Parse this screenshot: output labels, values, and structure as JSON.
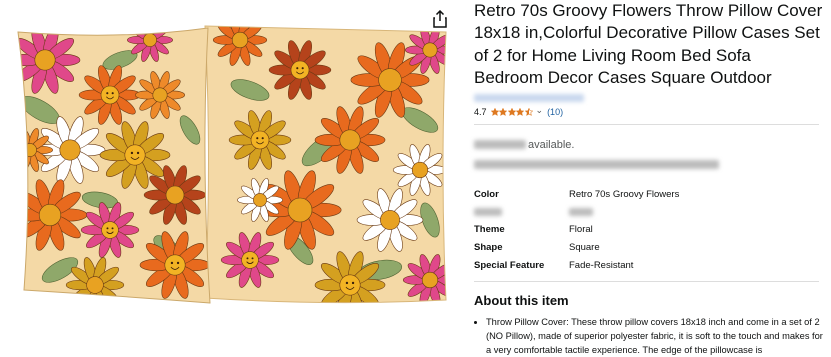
{
  "product": {
    "title": "Retro 70s Groovy Flowers Throw Pillow Cover 18x18 in,Colorful Decorative Pillow Cases Set of 2 for Home Living Room Bed Sofa Bedroom Decor Cases Square Outdoor",
    "rating": "4.7",
    "rating_stars": 4.5,
    "rating_count": "(10)",
    "availability_partial": "available.",
    "colors": {
      "star": "#de7921",
      "link": "#2162a1",
      "text": "#0f1111"
    }
  },
  "attributes": [
    {
      "key": "Color",
      "value": "Retro 70s Groovy Flowers"
    },
    {
      "key": "",
      "value": ""
    },
    {
      "key": "Theme",
      "value": "Floral"
    },
    {
      "key": "Shape",
      "value": "Square"
    },
    {
      "key": "Special Feature",
      "value": "Fade-Resistant"
    }
  ],
  "about": {
    "heading": "About this item",
    "bullets": [
      "Throw Pillow Cover: These throw pillow covers 18x18 inch and come in a set of 2 (NO Pillow), made of superior polyester fabric, it is soft to the touch and makes for a very comfortable tactile experience. The edge of the pillowcase is"
    ]
  },
  "icons": {
    "share": "share-icon",
    "star": "star-icon",
    "chevron": "chevron-down-icon"
  }
}
